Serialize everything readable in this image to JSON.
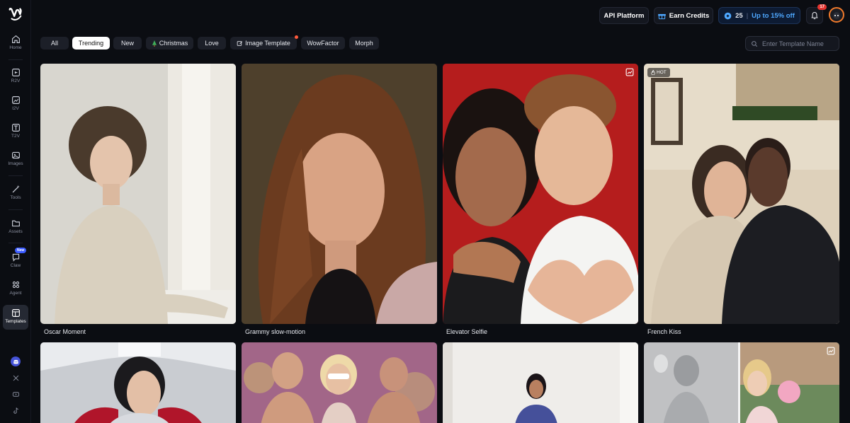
{
  "sidebar": {
    "items": [
      {
        "label": "Home",
        "icon": "home-icon"
      },
      {
        "label": "R2V",
        "icon": "r2v-icon"
      },
      {
        "label": "I2V",
        "icon": "image-to-video-icon"
      },
      {
        "label": "T2V",
        "icon": "text-to-video-icon"
      },
      {
        "label": "Images",
        "icon": "images-icon"
      },
      {
        "label": "Tools",
        "icon": "wand-icon"
      },
      {
        "label": "Assets",
        "icon": "folder-icon"
      },
      {
        "label": "Claw",
        "icon": "chat-icon",
        "badge": "New"
      },
      {
        "label": "Agent",
        "icon": "agent-icon"
      },
      {
        "label": "Templates",
        "icon": "templates-icon",
        "active": true
      }
    ],
    "social": [
      "discord-icon",
      "x-icon",
      "youtube-icon",
      "tiktok-icon"
    ]
  },
  "header": {
    "api_platform": "API Platform",
    "earn_credits": "Earn Credits",
    "credits_count": "25",
    "credits_sep": "|",
    "promo": "Up to 15% off",
    "notifications": "17"
  },
  "filters": {
    "tabs": [
      {
        "label": "All"
      },
      {
        "label": "Trending",
        "active": true
      },
      {
        "label": "New"
      },
      {
        "label": "Christmas",
        "icon": "tree-icon"
      },
      {
        "label": "Love"
      },
      {
        "label": "Image Template",
        "icon": "edit-icon",
        "dot": true
      },
      {
        "label": "WowFactor"
      },
      {
        "label": "Morph"
      }
    ],
    "search_placeholder": "Enter Template Name"
  },
  "templates": [
    {
      "title": "Oscar Moment"
    },
    {
      "title": "Grammy slow-motion"
    },
    {
      "title": "Elevator Selfie",
      "corner": "image-template-icon"
    },
    {
      "title": "French Kiss",
      "badge": "HOT"
    },
    {
      "title": ""
    },
    {
      "title": ""
    },
    {
      "title": ""
    },
    {
      "title": "",
      "corner": "image-template-icon"
    }
  ],
  "colors": {
    "background": "#0b0d12",
    "accent": "#4ea8ff",
    "hot": "#ff5a3c",
    "notification": "#e3342f"
  }
}
